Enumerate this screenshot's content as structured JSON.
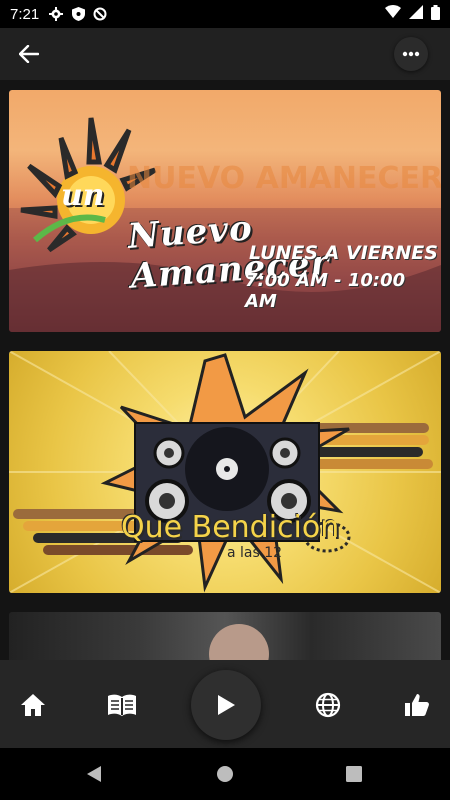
{
  "status_bar": {
    "time": "7:21",
    "left_icons": [
      "settings-icon",
      "shield-icon",
      "no-sync-icon"
    ],
    "right_icons": [
      "wifi-icon",
      "signal-icon",
      "battery-icon"
    ]
  },
  "app_bar": {
    "back_icon": "arrow-back-icon",
    "more_icon": "more-horizontal-icon"
  },
  "cards": [
    {
      "name": "Nuevo Amanecer",
      "prefix": "un",
      "title": "Nuevo Amanecer",
      "days": "LUNES A VIERNES",
      "hours": "7:00 AM - 10:00 AM"
    },
    {
      "name": "Que Bendición",
      "title": "Que Bendición",
      "subtitle": "a las 12"
    },
    {
      "name": "partial-card"
    }
  ],
  "bottom_nav": {
    "items": [
      "home-icon",
      "book-icon",
      "play-icon",
      "globe-icon",
      "thumbs-up-icon"
    ]
  },
  "system_nav": [
    "back-triangle-icon",
    "home-circle-icon",
    "recents-square-icon"
  ],
  "colors": {
    "app_bar": "#212121",
    "bottom_nav": "#262626",
    "status_bar": "#000000"
  }
}
